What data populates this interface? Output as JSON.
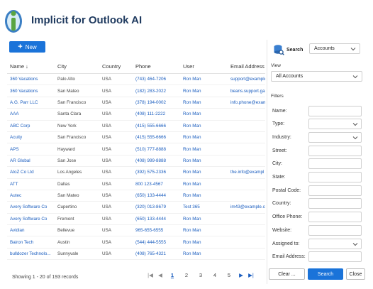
{
  "app": {
    "title": "Implicit for Outlook AI"
  },
  "toolbar": {
    "new_label": "New"
  },
  "grid": {
    "columns": [
      "Name ↓",
      "City",
      "Country",
      "Phone",
      "User",
      "Email Address"
    ],
    "rows": [
      {
        "name": "360 Vacations",
        "city": "Palo Alto",
        "country": "USA",
        "phone": "(743) 464-7206",
        "user": "Ron Man",
        "email": "support@example"
      },
      {
        "name": "360 Vacations",
        "city": "San Mateo",
        "country": "USA",
        "phone": "(182) 283-2022",
        "user": "Ron Man",
        "email": "beans.support.ga"
      },
      {
        "name": "A.G. Parr LLC",
        "city": "San Francisco",
        "country": "USA",
        "phone": "(378) 194-0002",
        "user": "Ron Man",
        "email": "info.phone@exam"
      },
      {
        "name": "AAA",
        "city": "Santa Clara",
        "country": "USA",
        "phone": "(408) 111-2222",
        "user": "Ron Man",
        "email": ""
      },
      {
        "name": "ABC Corp",
        "city": "New York",
        "country": "USA",
        "phone": "(415) 555-6666",
        "user": "Ron Man",
        "email": ""
      },
      {
        "name": "Acuity",
        "city": "San Francisco",
        "country": "USA",
        "phone": "(415) 555-6666",
        "user": "Ron Man",
        "email": ""
      },
      {
        "name": "APS",
        "city": "Hayward",
        "country": "USA",
        "phone": "(510) 777-8888",
        "user": "Ron Man",
        "email": ""
      },
      {
        "name": "AR Global",
        "city": "San Jose",
        "country": "USA",
        "phone": "(408) 999-8888",
        "user": "Ron Man",
        "email": ""
      },
      {
        "name": "AtoZ Co Ltd",
        "city": "Los Angeles",
        "country": "USA",
        "phone": "(392) 575-2336",
        "user": "Ron Man",
        "email": "the.info@exampl"
      },
      {
        "name": "ATT",
        "city": "Dallas",
        "country": "USA",
        "phone": "800 123-4567",
        "user": "Ron Man",
        "email": ""
      },
      {
        "name": "Autec",
        "city": "San Mateo",
        "country": "USA",
        "phone": "(650) 133-4444",
        "user": "Ron Man",
        "email": ""
      },
      {
        "name": "Avery Software Co",
        "city": "Cupertino",
        "country": "USA",
        "phone": "(320) 013-8679",
        "user": "Test 365",
        "email": "im43@example.co"
      },
      {
        "name": "Avery Software Co",
        "city": "Fremont",
        "country": "USA",
        "phone": "(650) 133-4444",
        "user": "Ron Man",
        "email": ""
      },
      {
        "name": "Avidian",
        "city": "Bellevue",
        "country": "USA",
        "phone": "965-655-6555",
        "user": "Ron Man",
        "email": ""
      },
      {
        "name": "Bairon Tech",
        "city": "Austin",
        "country": "USA",
        "phone": "(544) 444-5555",
        "user": "Ron Man",
        "email": ""
      },
      {
        "name": "bulldozer Technolo...",
        "city": "Sunnyvale",
        "country": "USA",
        "phone": "(408) 765-4321",
        "user": "Ron Man",
        "email": ""
      }
    ]
  },
  "footer": {
    "records_text": "Showing 1 - 20 of 193 records",
    "pages": [
      "1",
      "2",
      "3",
      "4",
      "5"
    ],
    "current_page": "1"
  },
  "panel": {
    "search_label": "Search",
    "search_entity": "Accounts",
    "view_label": "View",
    "view_value": "All Accounts",
    "filters_label": "Filters",
    "filters": [
      {
        "label": "Name:",
        "type": "text"
      },
      {
        "label": "Type:",
        "type": "select"
      },
      {
        "label": "Industry:",
        "type": "select"
      },
      {
        "label": "Street:",
        "type": "text"
      },
      {
        "label": "City:",
        "type": "text"
      },
      {
        "label": "State:",
        "type": "text"
      },
      {
        "label": "Postal Code:",
        "type": "text"
      },
      {
        "label": "Country:",
        "type": "text"
      },
      {
        "label": "Office Phone:",
        "type": "text"
      },
      {
        "label": "Website:",
        "type": "text"
      },
      {
        "label": "Assigned to:",
        "type": "select"
      },
      {
        "label": "Email Address:",
        "type": "text"
      }
    ],
    "clear_label": "Clear ...",
    "search_button_label": "Search",
    "close_label": "Close"
  },
  "colors": {
    "accent": "#1a73d9",
    "link": "#1a5dbf",
    "title": "#1f3a5f"
  }
}
